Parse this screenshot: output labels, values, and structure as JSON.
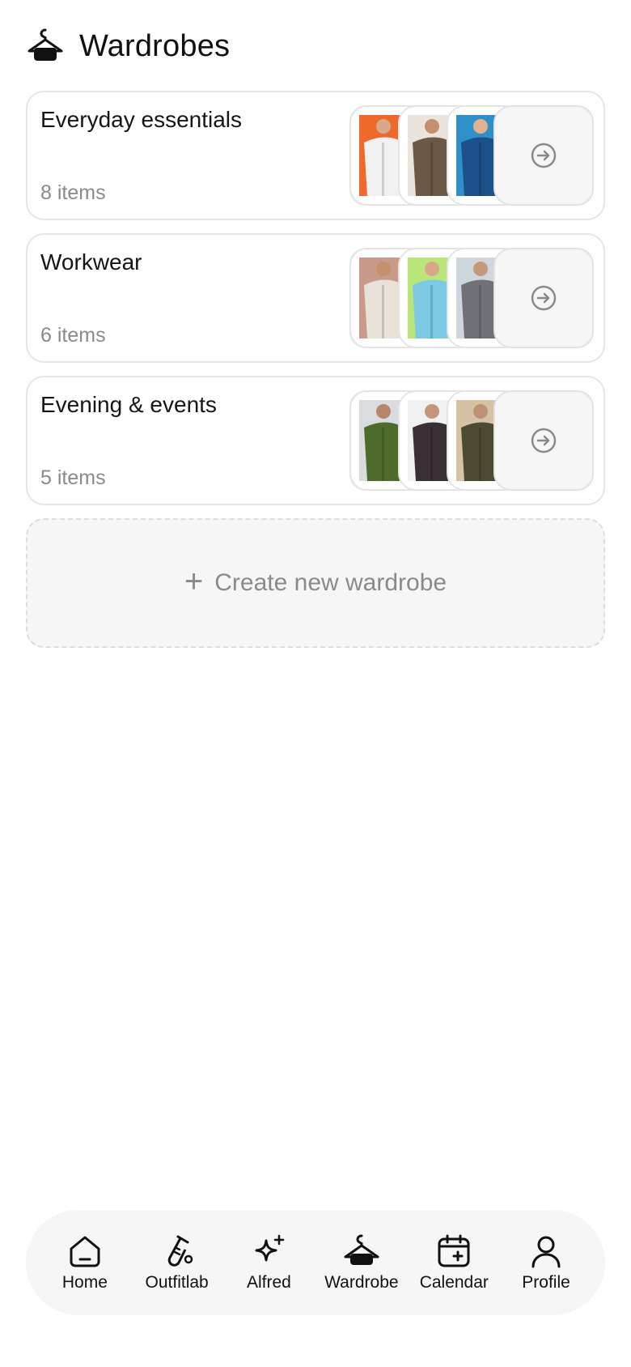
{
  "header": {
    "title": "Wardrobes",
    "icon": "hanger-icon"
  },
  "wardrobes": [
    {
      "name": "Everyday essentials",
      "count": "8 items",
      "thumbnails": [
        {
          "bg": "#ef6a2a",
          "shirt": "#f1f1f1",
          "skin": "#d7a98a"
        },
        {
          "bg": "#ebe4dc",
          "shirt": "#6b5846",
          "skin": "#c58e6c"
        },
        {
          "bg": "#2f8fc9",
          "shirt": "#1d4f8a",
          "skin": "#e0b28f"
        }
      ]
    },
    {
      "name": "Workwear",
      "count": "6 items",
      "thumbnails": [
        {
          "bg": "#c99a8a",
          "shirt": "#e8e2d8",
          "skin": "#c58e6c"
        },
        {
          "bg": "#b9e57a",
          "shirt": "#7cc9e4",
          "skin": "#d8a88a"
        },
        {
          "bg": "#cfd6dd",
          "shirt": "#6f7177",
          "skin": "#c5987a"
        }
      ]
    },
    {
      "name": "Evening & events",
      "count": "5 items",
      "thumbnails": [
        {
          "bg": "#d9dde0",
          "shirt": "#4f6b2c",
          "skin": "#b8876a"
        },
        {
          "bg": "#f1f1f1",
          "shirt": "#3a2f35",
          "skin": "#c7957a"
        },
        {
          "bg": "#d6c2a5",
          "shirt": "#4d4a33",
          "skin": "#c09275"
        }
      ]
    }
  ],
  "create": {
    "label": "Create new wardrobe",
    "icon": "plus-icon"
  },
  "nav": [
    {
      "label": "Home",
      "icon": "home-icon"
    },
    {
      "label": "Outfitlab",
      "icon": "test-tube-icon"
    },
    {
      "label": "Alfred",
      "icon": "sparkles-icon"
    },
    {
      "label": "Wardrobe",
      "icon": "hanger-icon"
    },
    {
      "label": "Calendar",
      "icon": "calendar-plus-icon"
    },
    {
      "label": "Profile",
      "icon": "user-icon"
    }
  ]
}
